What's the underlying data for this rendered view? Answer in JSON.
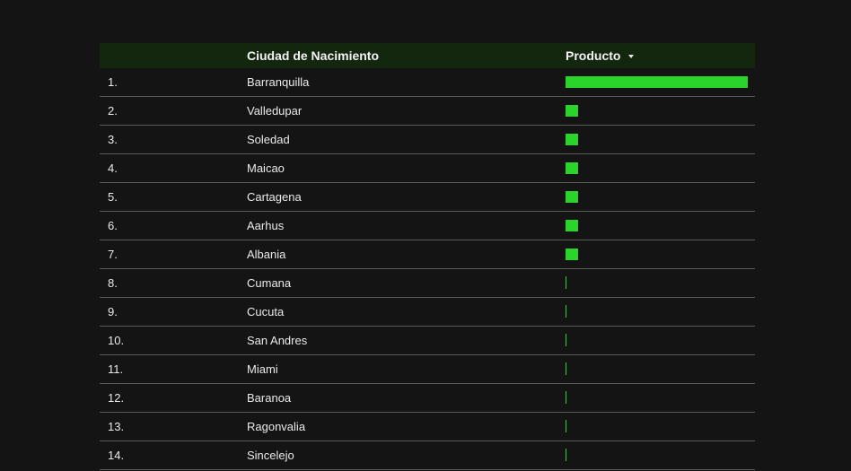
{
  "table": {
    "headers": {
      "city": "Ciudad de Nacimiento",
      "product": "Producto"
    },
    "sort_icon": "sort-descending-icon",
    "bar_color": "#2bd42b",
    "header_bg": "#13270f",
    "rows": [
      {
        "index": "1.",
        "city": "Barranquilla",
        "value": 1.0
      },
      {
        "index": "2.",
        "city": "Valledupar",
        "value": 0.07
      },
      {
        "index": "3.",
        "city": "Soledad",
        "value": 0.07
      },
      {
        "index": "4.",
        "city": "Maicao",
        "value": 0.07
      },
      {
        "index": "5.",
        "city": "Cartagena",
        "value": 0.07
      },
      {
        "index": "6.",
        "city": "Aarhus",
        "value": 0.07
      },
      {
        "index": "7.",
        "city": "Albania",
        "value": 0.07
      },
      {
        "index": "8.",
        "city": "Cumana",
        "value": 0.005
      },
      {
        "index": "9.",
        "city": "Cucuta",
        "value": 0.005
      },
      {
        "index": "10.",
        "city": "San Andres",
        "value": 0.005
      },
      {
        "index": "11.",
        "city": "Miami",
        "value": 0.005
      },
      {
        "index": "12.",
        "city": "Baranoa",
        "value": 0.005
      },
      {
        "index": "13.",
        "city": "Ragonvalia",
        "value": 0.005
      },
      {
        "index": "14.",
        "city": "Sincelejo",
        "value": 0.005
      }
    ]
  }
}
